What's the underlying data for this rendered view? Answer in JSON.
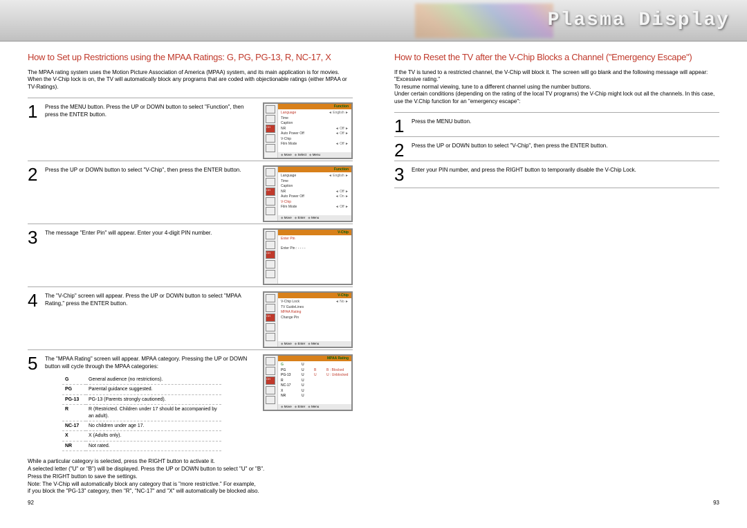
{
  "header": {
    "title": "Plasma Display"
  },
  "left": {
    "title": "How to Set up Restrictions using the MPAA Ratings: G, PG, PG-13, R, NC-17, X",
    "intro": "The MPAA rating system uses the Motion Picture Association of America (MPAA) system, and its main application is for movies. When the V-Chip lock is on, the TV will automatically block any programs that are coded with objectionable ratings (either MPAA or TV-Ratings).",
    "steps": [
      {
        "n": "1",
        "text": "Press the MENU button. Press the UP or DOWN button to select \"Function\", then press the ENTER button."
      },
      {
        "n": "2",
        "text": "Press the UP or DOWN button to select \"V-Chip\", then press the ENTER button."
      },
      {
        "n": "3",
        "text": "The message \"Enter Pin\" will appear. Enter your 4-digit PIN number."
      },
      {
        "n": "4",
        "text": "The \"V-Chip\" screen will appear. Press the UP or DOWN button to select \"MPAA Rating,\" press the ENTER button."
      },
      {
        "n": "5",
        "text": "The \"MPAA Rating\" screen will appear. MPAA category. Pressing the UP or DOWN button will cycle through the MPAA categories:"
      }
    ],
    "categories": [
      {
        "code": "G",
        "desc": "General audience (no restrictions)."
      },
      {
        "code": "PG",
        "desc": "Parental guidance suggested."
      },
      {
        "code": "PG-13",
        "desc": "PG-13 (Parents strongly cautioned)."
      },
      {
        "code": "R",
        "desc": "R (Restricted. Children under 17 should be accompanied by an adult)."
      },
      {
        "code": "NC-17",
        "desc": "No children under age 17."
      },
      {
        "code": "X",
        "desc": "X (Adults only)."
      },
      {
        "code": "NR",
        "desc": "Not rated."
      }
    ],
    "osd": {
      "function_title": "Function",
      "vchip_title": "V-Chip",
      "mpaa_title": "MPAA Rating",
      "lang_label": "Language",
      "lang_val": "◄ English ►",
      "time_label": "Time",
      "caption_label": "Caption",
      "nr_label": "NR",
      "off_val": "◄ Off ►",
      "auto_label": "Auto Power Off",
      "vchip_label": "V-Chip",
      "on_val": "◄ On ►",
      "film_label": "Film Mode",
      "move": "Move",
      "select": "Select",
      "enter": "Enter",
      "menu": "Menu",
      "enter_pin": "Enter Pin",
      "pin_dots": "Enter Pin    : - - - -",
      "vlock": "V-Chip Lock",
      "vlock_val": "◄ No ►",
      "tvg": "TV GuideLines",
      "mpaa": "MPAA Rating",
      "chpin": "Change Pin",
      "r_g": "G",
      "r_pg": "PG",
      "r_pg13": "PG-13",
      "r_r": "R",
      "r_nc17": "NC-17",
      "r_x": "X",
      "r_nr": "NR",
      "blocked": "B : Blocked",
      "unblocked": "U : Unblocked"
    },
    "bottom": "While a particular category is selected, press the RIGHT button to activate it.\nA selected letter (\"U\" or \"B\") will be displayed. Press the UP or DOWN button to select \"U\" or \"B\".\nPress the RIGHT button to save the settings.\nNote: The V-Chip will automatically block any category that is \"more restrictive.\" For example,\nif you block the \"PG-13\" category, then \"R\", \"NC-17\" and \"X\" will automatically be blocked also.",
    "page_num": "92"
  },
  "right": {
    "title": "How to Reset the TV after the V-Chip Blocks a Channel (\"Emergency Escape\")",
    "intro": "If the TV is tuned to a restricted channel, the V-Chip will block it. The screen will go blank and the following message will appear: \"Excessive rating.\"\nTo resume normal viewing, tune to a different channel using the number buttons.\nUnder certain conditions (depending on the rating of the local TV programs) the V-Chip might lock out all the channels. In this case, use the V.Chip function for an \"emergency escape\":",
    "steps": [
      {
        "n": "1",
        "text": "Press the MENU button."
      },
      {
        "n": "2",
        "text": "Press the UP or DOWN button to select \"V-Chip\", then press the ENTER button."
      },
      {
        "n": "3",
        "text": "Enter your PIN number, and press the RIGHT button to temporarily disable the V-Chip Lock."
      }
    ],
    "page_num": "93"
  }
}
